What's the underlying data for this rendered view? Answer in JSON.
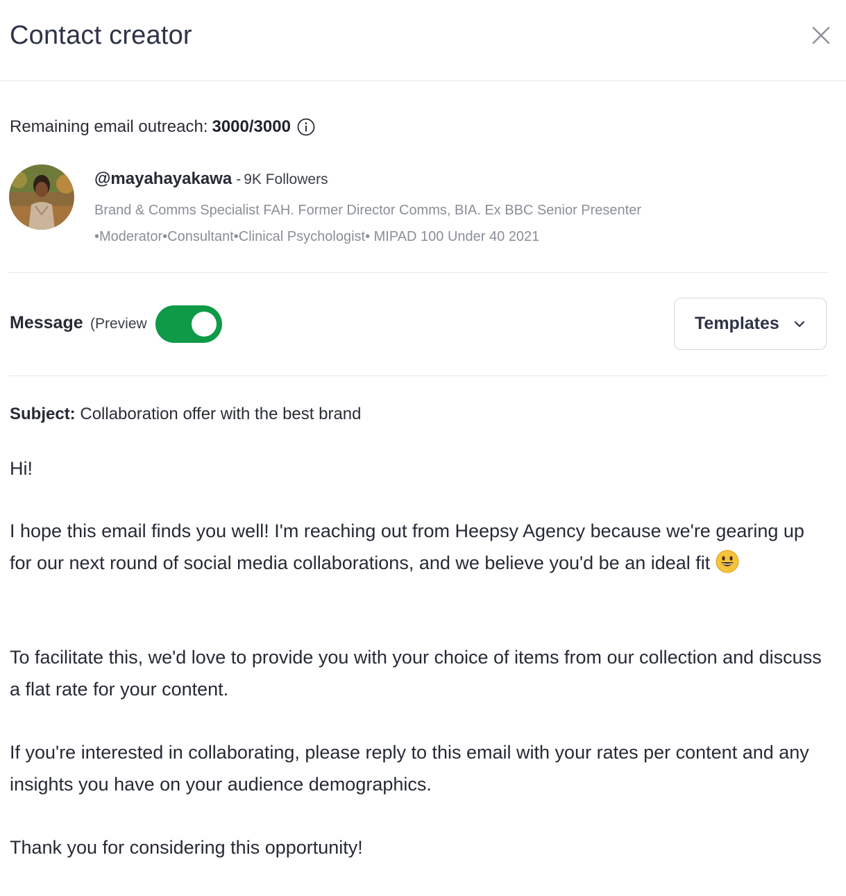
{
  "header": {
    "title": "Contact creator"
  },
  "outreach": {
    "label": "Remaining email outreach:",
    "value": "3000/3000"
  },
  "creator": {
    "handle": "@mayahayakawa",
    "separator": "-",
    "followers": "9K Followers",
    "bio": "Brand & Comms Specialist FAH. Former Director Comms, BIA. Ex BBC Senior Presenter •Moderator•Consultant•Clinical Psychologist• MIPAD 100 Under 40 2021"
  },
  "message": {
    "label": "Message",
    "preview_label": "(Preview",
    "preview_enabled": true,
    "templates_label": "Templates"
  },
  "email": {
    "subject_label": "Subject:",
    "subject": "Collaboration offer with the best brand",
    "greeting": "Hi!",
    "p1": "I hope this email finds you well! I'm reaching out from Heepsy Agency because we're gearing up for our next round of social media collaborations, and we believe you'd be an ideal fit",
    "p2": "To facilitate this, we'd love to provide you with your choice of items from our collection and discuss a flat rate for your content.",
    "p3": "If you're interested in collaborating, please reply to this email with your rates per content and any insights you have on your audience demographics.",
    "closing": "Thank you for considering this opportunity!"
  },
  "colors": {
    "toggle_on": "#0e9a47",
    "title": "#2e3348",
    "muted": "#8a8e98",
    "divider": "#e6e7ea"
  },
  "icons": [
    "close-icon",
    "info-icon",
    "chevron-down-icon",
    "smiley-emoji-icon"
  ]
}
